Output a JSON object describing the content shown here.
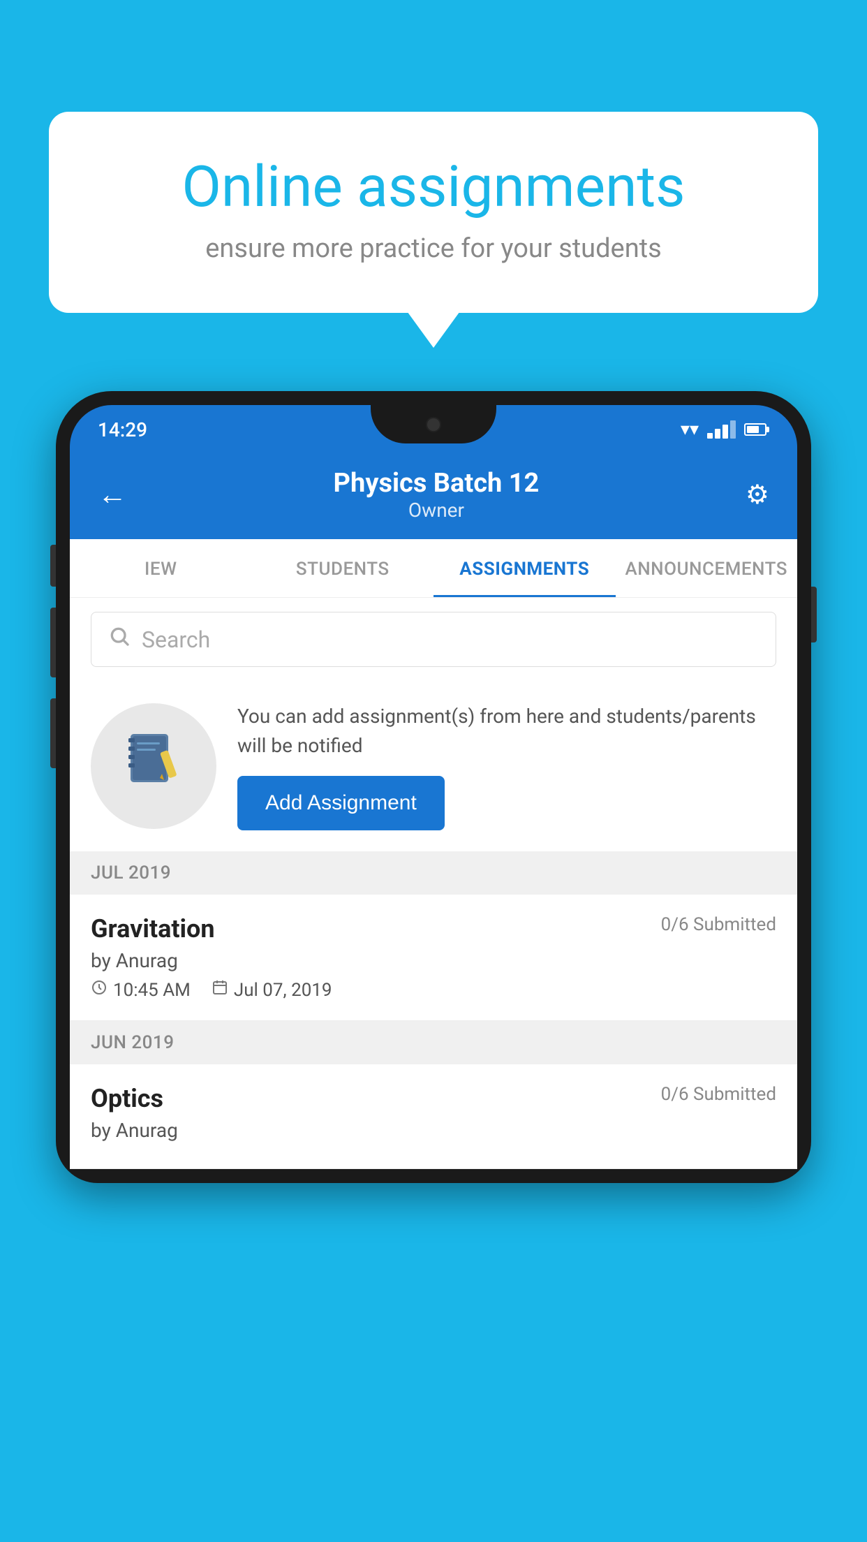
{
  "background_color": "#1ab6e8",
  "speech_bubble": {
    "title": "Online assignments",
    "subtitle": "ensure more practice for your students"
  },
  "phone": {
    "status_bar": {
      "time": "14:29"
    },
    "header": {
      "title": "Physics Batch 12",
      "subtitle": "Owner",
      "back_label": "←",
      "settings_label": "⚙"
    },
    "tabs": [
      {
        "label": "IEW",
        "active": false
      },
      {
        "label": "STUDENTS",
        "active": false
      },
      {
        "label": "ASSIGNMENTS",
        "active": true
      },
      {
        "label": "ANNOUNCEMENTS",
        "active": false
      }
    ],
    "search": {
      "placeholder": "Search"
    },
    "promo": {
      "description": "You can add assignment(s) from here and students/parents will be notified",
      "button_label": "Add Assignment"
    },
    "sections": [
      {
        "label": "JUL 2019",
        "assignments": [
          {
            "title": "Gravitation",
            "submitted": "0/6 Submitted",
            "author": "by Anurag",
            "time": "10:45 AM",
            "date": "Jul 07, 2019"
          }
        ]
      },
      {
        "label": "JUN 2019",
        "assignments": [
          {
            "title": "Optics",
            "submitted": "0/6 Submitted",
            "author": "by Anurag",
            "time": "",
            "date": ""
          }
        ]
      }
    ]
  }
}
